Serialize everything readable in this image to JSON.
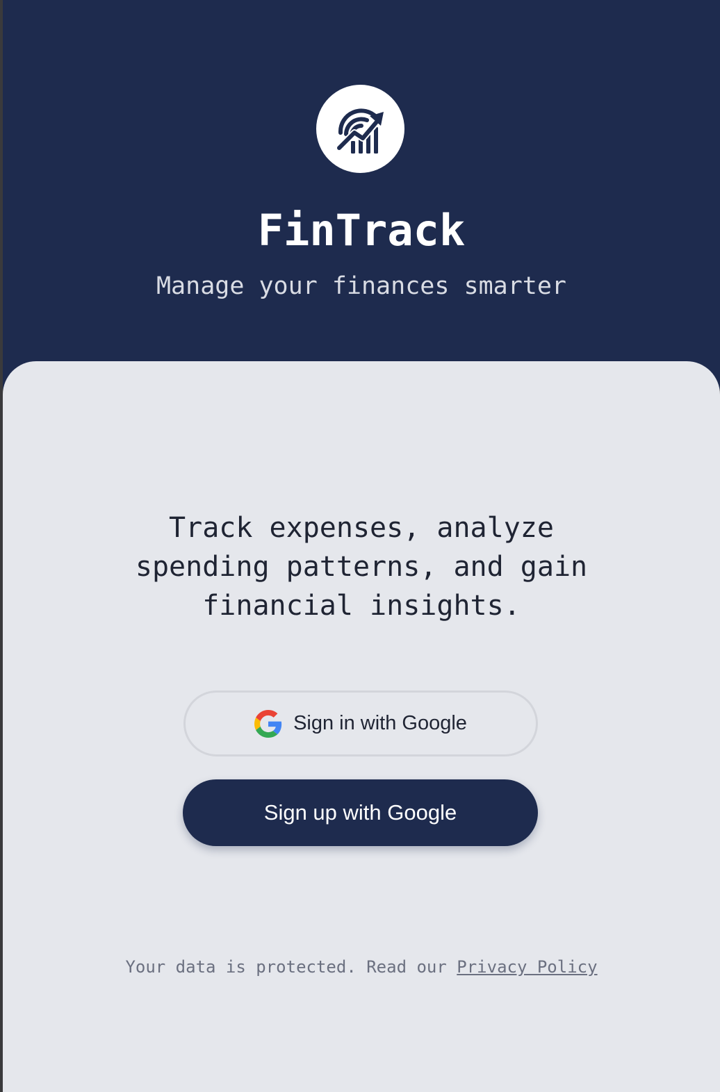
{
  "brand": {
    "logo_icon": "growth-chart-icon",
    "title": "FinTrack",
    "subtitle": "Manage your finances smarter",
    "primary_color": "#1e2b4e"
  },
  "main": {
    "tagline": "Track expenses, analyze spending patterns, and gain financial insights.",
    "signin_button": {
      "label": "Sign in with Google",
      "icon": "google-icon"
    },
    "signup_button": {
      "label": "Sign up with Google"
    }
  },
  "footer": {
    "text": "Your data is protected. Read our ",
    "link_label": "Privacy Policy"
  }
}
